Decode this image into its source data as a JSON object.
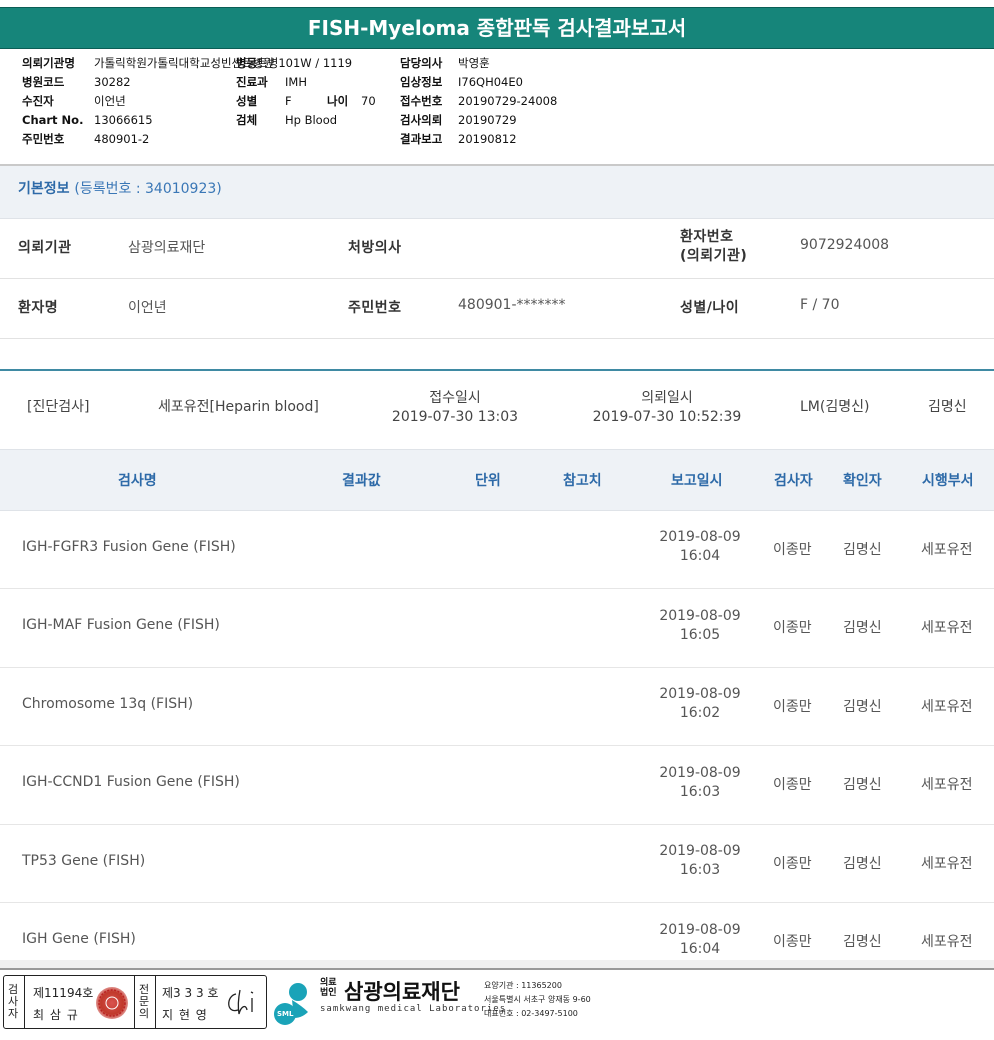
{
  "title": "FISH-Myeloma 종합판독 검사결과보고서",
  "header": {
    "col1": [
      {
        "k": "의뢰기관명",
        "v": "가톨릭학원가톨릭대학교성빈센트병원"
      },
      {
        "k": "병원코드",
        "v": "30282"
      },
      {
        "k": "수진자",
        "v": "이언년"
      },
      {
        "k": "Chart No.",
        "v": "13066615"
      },
      {
        "k": "주민번호",
        "v": "480901-2"
      }
    ],
    "ward": {
      "k": "병동",
      "v": "트병101W / 1119"
    },
    "dept": {
      "k": "진료과",
      "v": "IMH"
    },
    "sex": {
      "k": "성별",
      "v": "F"
    },
    "age": {
      "k": "나이",
      "v": "70"
    },
    "specimen": {
      "k": "검체",
      "v": "Hp Blood"
    },
    "col3": [
      {
        "k": "담당의사",
        "v": "박영훈"
      },
      {
        "k": "임상정보",
        "v": "I76QH04E0"
      },
      {
        "k": "접수번호",
        "v": "20190729-24008"
      },
      {
        "k": "검사의뢰",
        "v": "20190729"
      },
      {
        "k": "결과보고",
        "v": "20190812"
      }
    ]
  },
  "basic": {
    "title": "기본정보",
    "reg": "(등록번호 : 34010923)",
    "institution_label": "의뢰기관",
    "institution_value": "삼광의료재단",
    "doctor_label": "처방의사",
    "doctor_value": "",
    "patient_no_label_1": "환자번호",
    "patient_no_label_2": "(의뢰기관)",
    "patient_no_value": "9072924008",
    "name_label": "환자명",
    "name_value": "이언년",
    "rrn_label": "주민번호",
    "rrn_value": "480901-*******",
    "sexage_label": "성별/나이",
    "sexage_value": "F / 70"
  },
  "diagnosis": {
    "category": "[진단검사]",
    "dept": "세포유전[Heparin blood]",
    "received_label": "접수일시",
    "received_value": "2019-07-30 13:03",
    "requested_label": "의뢰일시",
    "requested_value": "2019-07-30 10:52:39",
    "lm": "LM(김명신)",
    "name": "김명신"
  },
  "table": {
    "headers": [
      "검사명",
      "결과값",
      "단위",
      "참고치",
      "보고일시",
      "검사자",
      "확인자",
      "시행부서"
    ],
    "rows": [
      {
        "test": "IGH-FGFR3 Fusion Gene (FISH)",
        "date": "2019-08-09",
        "time": "16:04",
        "tester": "이종만",
        "checker": "김명신",
        "dept": "세포유전"
      },
      {
        "test": "IGH-MAF Fusion Gene (FISH)",
        "date": "2019-08-09",
        "time": "16:05",
        "tester": "이종만",
        "checker": "김명신",
        "dept": "세포유전"
      },
      {
        "test": "Chromosome 13q (FISH)",
        "date": "2019-08-09",
        "time": "16:02",
        "tester": "이종만",
        "checker": "김명신",
        "dept": "세포유전"
      },
      {
        "test": "IGH-CCND1 Fusion Gene (FISH)",
        "date": "2019-08-09",
        "time": "16:03",
        "tester": "이종만",
        "checker": "김명신",
        "dept": "세포유전"
      },
      {
        "test": "TP53 Gene (FISH)",
        "date": "2019-08-09",
        "time": "16:03",
        "tester": "이종만",
        "checker": "김명신",
        "dept": "세포유전"
      },
      {
        "test": "IGH Gene (FISH)",
        "date": "2019-08-09",
        "time": "16:04",
        "tester": "이종만",
        "checker": "김명신",
        "dept": "세포유전"
      }
    ]
  },
  "footer": {
    "v1": [
      "검",
      "사",
      "자"
    ],
    "lic1": "제11194호",
    "name1": "최 삼 규",
    "v2": [
      "전",
      "문",
      "의"
    ],
    "lic2": "제3 3 3 호",
    "name2": "지 현 영",
    "logo_small_1": "의료",
    "logo_small_2": "법인",
    "logo_main": "삼광의료재단",
    "logo_sub": "samkwang medical Laboratories",
    "logo_circle": "SML",
    "contact1": "요양기관 : 11365200",
    "contact2": "서울특별시 서초구 양재동 9-60",
    "contact3": "대표번호 : 02-3497-5100"
  }
}
